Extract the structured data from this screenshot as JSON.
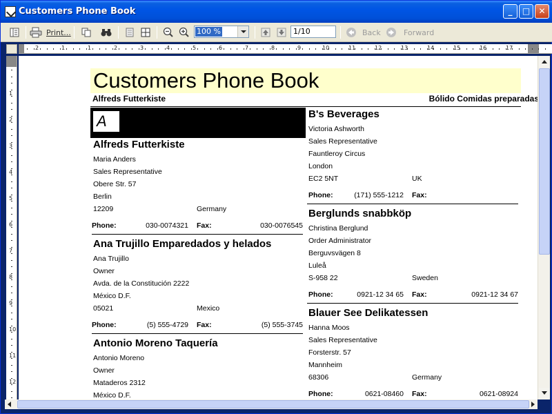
{
  "window": {
    "title": "Customers Phone Book"
  },
  "toolbar": {
    "print_label": "Print...",
    "zoom_value": "100 %",
    "page_value": "1/10",
    "back_label": "Back",
    "forward_label": "Forward"
  },
  "ruler": {
    "h_numbers": [
      "2",
      "1",
      "1",
      "2",
      "3",
      "4",
      "5",
      "6",
      "7",
      "8",
      "9",
      "10",
      "11",
      "12",
      "13",
      "14",
      "15",
      "16",
      "17"
    ],
    "v_numbers": [
      "1",
      "2",
      "3",
      "4",
      "5",
      "6",
      "7",
      "8",
      "9",
      "10",
      "11",
      "12"
    ]
  },
  "report": {
    "title": "Customers Phone Book",
    "header_left": "Alfreds Futterkiste",
    "header_right": "Bólido Comidas preparadas",
    "group_letter": "A",
    "phone_label": "Phone:",
    "fax_label": "Fax:",
    "customers": [
      {
        "name": "Alfreds Futterkiste",
        "contact": "Maria Anders",
        "title": "Sales Representative",
        "address": "Obere Str. 57",
        "city": "Berlin",
        "postal": "12209",
        "country": "Germany",
        "phone": "030-0074321",
        "fax": "030-0076545"
      },
      {
        "name": "Ana Trujillo Emparedados y helados",
        "contact": "Ana Trujillo",
        "title": "Owner",
        "address": "Avda. de la Constitución 2222",
        "city": "México D.F.",
        "postal": "05021",
        "country": "Mexico",
        "phone": "(5) 555-4729",
        "fax": "(5) 555-3745"
      },
      {
        "name": "Antonio Moreno Taquería",
        "contact": "Antonio Moreno",
        "title": "Owner",
        "address": "Mataderos  2312",
        "city": "México D.F."
      },
      {
        "name": "B's Beverages",
        "contact": "Victoria Ashworth",
        "title": "Sales Representative",
        "address": "Fauntleroy Circus",
        "city": "London",
        "postal": "EC2 5NT",
        "country": "UK",
        "phone": "(171) 555-1212",
        "fax": ""
      },
      {
        "name": "Berglunds snabbköp",
        "contact": "Christina Berglund",
        "title": "Order Administrator",
        "address": "Berguvsvägen  8",
        "city": "Luleå",
        "postal": "S-958 22",
        "country": "Sweden",
        "phone": "0921-12 34 65",
        "fax": "0921-12 34 67"
      },
      {
        "name": "Blauer See Delikatessen",
        "contact": "Hanna Moos",
        "title": "Sales Representative",
        "address": "Forsterstr. 57",
        "city": "Mannheim",
        "postal": "68306",
        "country": "Germany",
        "phone": "0621-08460",
        "fax": "0621-08924"
      }
    ]
  }
}
